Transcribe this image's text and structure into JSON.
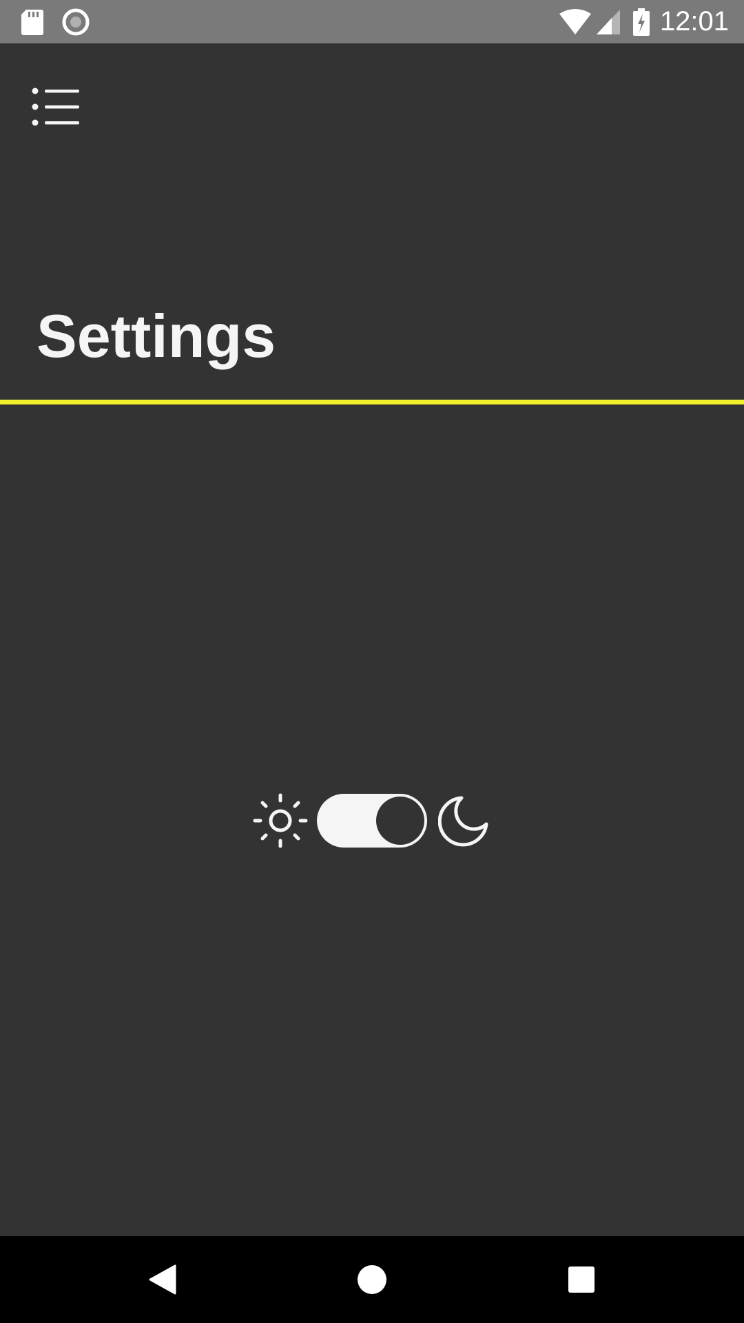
{
  "status_bar": {
    "time": "12:01",
    "icons": [
      "sd-card-icon",
      "sync-icon",
      "wifi-icon",
      "cell-signal-icon",
      "battery-charging-icon"
    ]
  },
  "header": {
    "menu_icon": "menu-icon",
    "title": "Settings"
  },
  "theme_switch": {
    "left_icon": "sun-icon",
    "right_icon": "moon-icon",
    "state": "dark"
  },
  "nav_bar": {
    "buttons": [
      "back-icon",
      "home-icon",
      "recents-icon"
    ]
  },
  "colors": {
    "background": "#333333",
    "status_bar": "#7a7a7a",
    "accent_divider": "#f0f02a",
    "foreground": "#f5f5f5",
    "nav_bar": "#000000"
  }
}
